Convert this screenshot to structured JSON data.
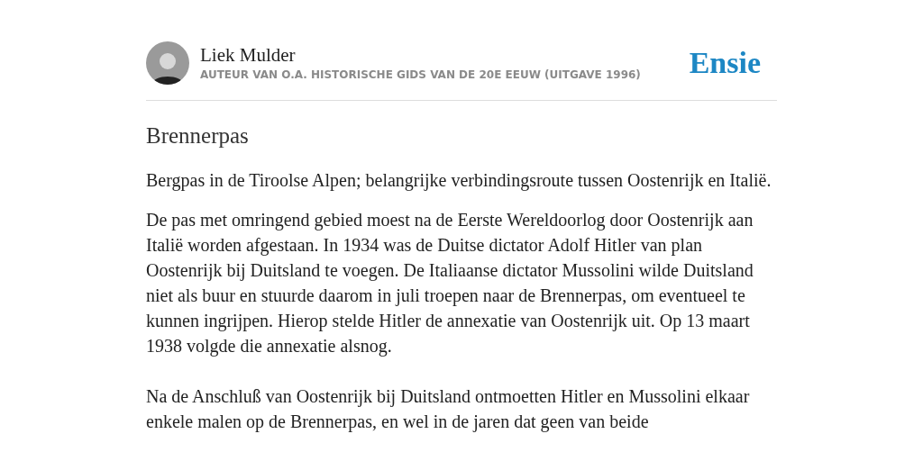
{
  "author": {
    "name": "Liek Mulder",
    "description": "AUTEUR VAN O.A. HISTORISCHE GIDS VAN DE 20E EEUW (UITGAVE 1996)"
  },
  "logo": "Ensie",
  "article": {
    "title": "Brennerpas",
    "paragraphs": [
      "Bergpas in de Tiroolse Alpen; belangrijke verbindingsroute tussen Oostenrijk en Italië.",
      "De pas met omringend gebied moest na de Eerste Wereldoorlog door Oostenrijk aan Italië worden afgestaan. In 1934 was de Duitse dictator Adolf Hitler van plan Oostenrijk bij Duitsland te voegen. De Italiaanse dictator Mussolini wilde Duitsland niet als buur en stuurde daarom in juli troepen naar de Brennerpas, om eventueel te kunnen ingrijpen. Hierop stelde Hitler de annexatie van Oostenrijk uit. Op 13 maart 1938 volgde die annexatie alsnog.",
      "Na de Anschluß van Oostenrijk bij Duitsland ontmoetten Hitler en Mussolini elkaar enkele malen op de Brennerpas, en wel in de jaren dat geen van beide"
    ]
  }
}
